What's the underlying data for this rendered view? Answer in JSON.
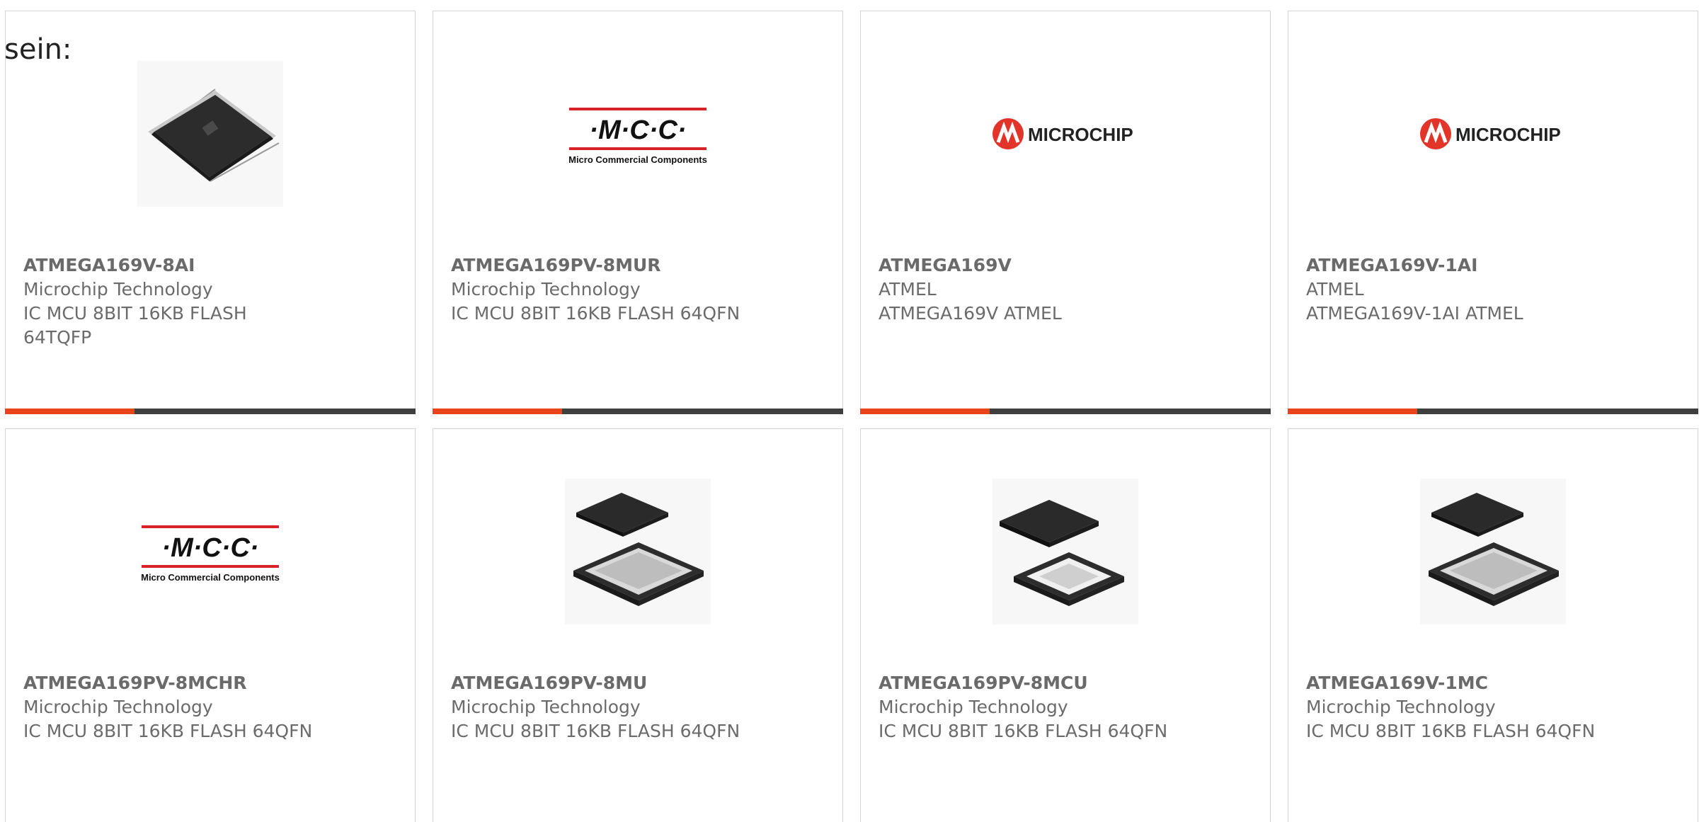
{
  "heading": "sein:",
  "products": [
    {
      "part": "ATMEGA169V-8AI",
      "maker": "Microchip Technology",
      "desc": "IC MCU 8BIT 16KB FLASH 64TQFP",
      "image": "tqfp-chip"
    },
    {
      "part": "ATMEGA169PV-8MUR",
      "maker": "Microchip Technology",
      "desc": "IC MCU 8BIT 16KB FLASH 64QFN",
      "image": "mcc-logo"
    },
    {
      "part": "ATMEGA169V",
      "maker": "ATMEL",
      "desc": "ATMEGA169V ATMEL",
      "image": "microchip-logo"
    },
    {
      "part": "ATMEGA169V-1AI",
      "maker": "ATMEL",
      "desc": "ATMEGA169V-1AI ATMEL",
      "image": "microchip-logo"
    },
    {
      "part": "ATMEGA169PV-8MCHR",
      "maker": "Microchip Technology",
      "desc": "IC MCU 8BIT 16KB FLASH 64QFN",
      "image": "mcc-logo"
    },
    {
      "part": "ATMEGA169PV-8MU",
      "maker": "Microchip Technology",
      "desc": "IC MCU 8BIT 16KB FLASH 64QFN",
      "image": "qfn-chip"
    },
    {
      "part": "ATMEGA169PV-8MCU",
      "maker": "Microchip Technology",
      "desc": "IC MCU 8BIT 16KB FLASH 64QFN",
      "image": "qfn-chip-open"
    },
    {
      "part": "ATMEGA169V-1MC",
      "maker": "Microchip Technology",
      "desc": "IC MCU 8BIT 16KB FLASH 64QFN",
      "image": "qfn-chip"
    }
  ],
  "logos": {
    "mcc_text": "·M·C·C·",
    "mcc_sub": "Micro Commercial Components",
    "microchip_text": "MICROCHIP"
  },
  "colors": {
    "accent": "#e8431a",
    "bar": "#3f3f3f",
    "mcc_red": "#d8232a",
    "microchip_red": "#e23428"
  }
}
